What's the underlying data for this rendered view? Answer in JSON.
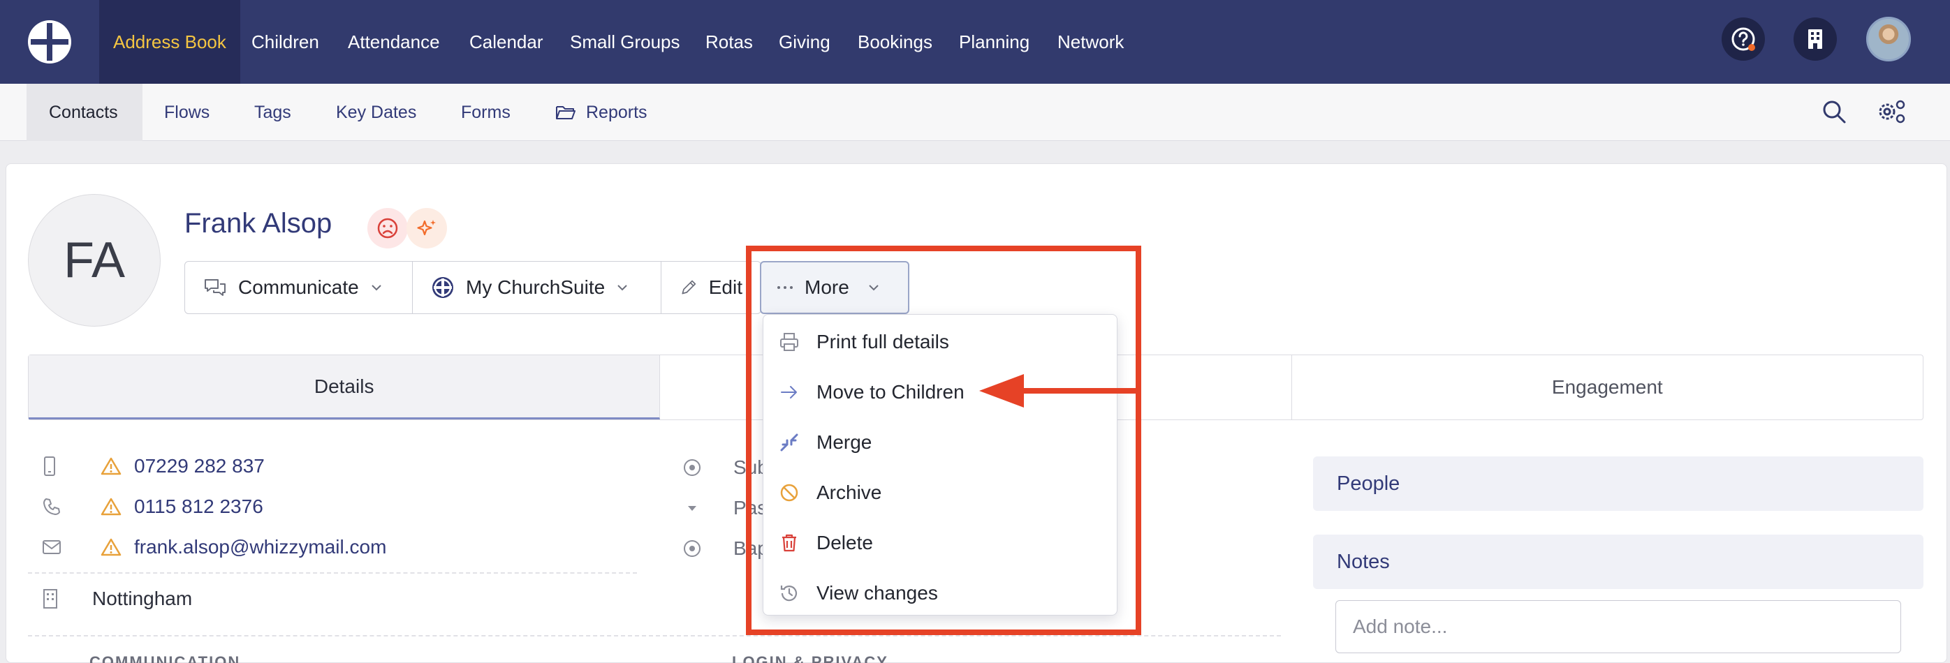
{
  "topnav": {
    "items": [
      "Address Book",
      "Children",
      "Attendance",
      "Calendar",
      "Small Groups",
      "Rotas",
      "Giving",
      "Bookings",
      "Planning",
      "Network"
    ],
    "active": "Address Book"
  },
  "subnav": {
    "items": [
      "Contacts",
      "Flows",
      "Tags",
      "Key Dates",
      "Forms",
      "Reports"
    ],
    "active": "Contacts"
  },
  "person": {
    "initials": "FA",
    "name": "Frank Alsop"
  },
  "actions": {
    "communicate": "Communicate",
    "mychurchsuite": "My ChurchSuite",
    "edit": "Edit",
    "more": "More"
  },
  "tabs": [
    "Details",
    "",
    "Engagement"
  ],
  "contact": {
    "mobile": "07229 282 837",
    "phone": "0115 812 2376",
    "email": "frank.alsop@whizzymail.com",
    "location": "Nottingham"
  },
  "mid_fields": [
    "Sub",
    "Pas",
    "Bap"
  ],
  "sections": {
    "communication": "COMMUNICATION",
    "login_privacy": "LOGIN & PRIVACY"
  },
  "side": {
    "people": "People",
    "notes": "Notes",
    "note_placeholder": "Add note..."
  },
  "menu": {
    "items": [
      "Print full details",
      "Move to Children",
      "Merge",
      "Archive",
      "Delete",
      "View changes"
    ]
  },
  "colors": {
    "nav_bg": "#323a6d",
    "nav_active_text": "#f4c542",
    "link": "#323a78",
    "warning": "#e8a13a",
    "annotation": "#e64226",
    "delete": "#d9413a"
  }
}
